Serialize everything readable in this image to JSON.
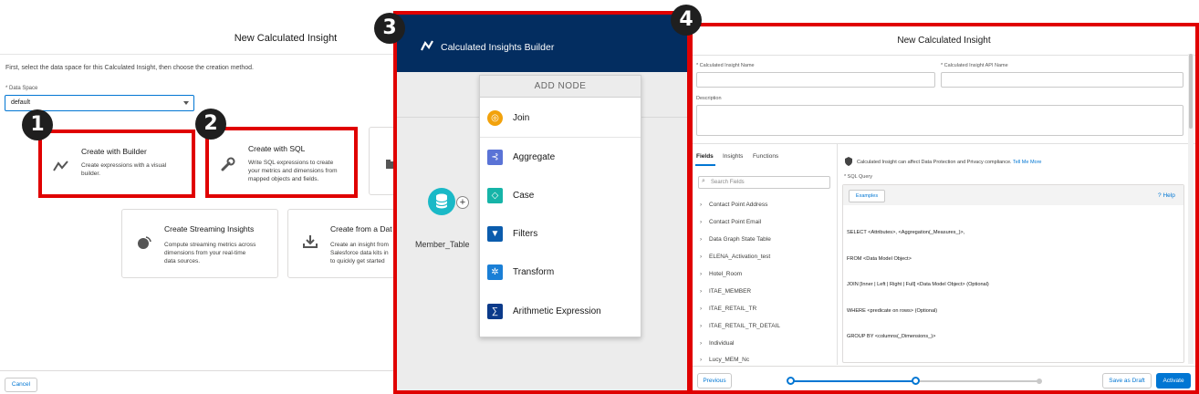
{
  "chooser": {
    "title": "New Calculated Insight",
    "intro": "First, select the data space for this Calculated Insight, then choose the creation method.",
    "data_space_label": "* Data Space",
    "data_space_value": "default",
    "cards": {
      "builder": {
        "title": "Create with Builder",
        "desc_1": "Create expressions with a visual",
        "desc_2": "builder."
      },
      "sql": {
        "title": "Create with SQL",
        "desc_1": "Write SQL expressions to create",
        "desc_2": "your metrics and dimensions from",
        "desc_3": "mapped objects and fields."
      },
      "streaming": {
        "title": "Create Streaming Insights",
        "desc_1": "Compute streaming metrics across",
        "desc_2": "dimensions from your real-time",
        "desc_3": "data sources."
      },
      "data_kit": {
        "title": "Create from a Dat",
        "desc_1": "Create an insight from",
        "desc_2": "Salesforce data kits in",
        "desc_3": "to quickly get started"
      }
    },
    "cancel_label": "Cancel"
  },
  "badges": {
    "one": "1",
    "two": "2",
    "three": "3",
    "four": "4"
  },
  "builder": {
    "header_title": "Calculated Insights Builder",
    "node_label": "Member_Table",
    "add_node_title": "ADD NODE",
    "items": [
      {
        "label": "Join",
        "icon": "join-icon",
        "color": "#f2a20c"
      },
      {
        "label": "Aggregate",
        "icon": "aggregate-icon",
        "color": "#5a73d6"
      },
      {
        "label": "Case",
        "icon": "case-icon",
        "color": "#16b4a8"
      },
      {
        "label": "Filters",
        "icon": "filter-icon",
        "color": "#0b5cad"
      },
      {
        "label": "Transform",
        "icon": "transform-icon",
        "color": "#1a7fd6"
      },
      {
        "label": "Arithmetic Expression",
        "icon": "sigma-icon",
        "color": "#0b3a8a"
      }
    ]
  },
  "editor": {
    "title": "New Calculated Insight",
    "label_name": "* Calculated Insight Name",
    "label_api": "* Calculated Insight API Name",
    "label_desc": "Description",
    "tabs": {
      "fields": "Fields",
      "insights": "Insights",
      "functions": "Functions"
    },
    "search_placeholder": "Search Fields",
    "fields": [
      "Contact Point Address",
      "Contact Point Email",
      "Data Graph State Table",
      "ELENA_Activation_test",
      "Hotel_Room",
      "ITAE_MEMBER",
      "ITAE_RETAIL_TR",
      "ITAE_RETAIL_TR_DETAIL",
      "Individual",
      "Lucy_MEM_Nc"
    ],
    "warning_text": "Calculated Insight can affect Data Protection and Privacy compliance.",
    "warning_link": "Tell Me More",
    "sql_label": "* SQL Query",
    "examples_label": "Examples",
    "help_label": "Help",
    "code": [
      "SELECT <Attributes>, <Aggregation(_Measures_)>,",
      "FROM <Data Model Object>",
      "JOIN [Inner | Left | Right | Full] <Data Model Object> (Optional)",
      "WHERE <predicate on rows> (Optional)",
      "GROUP BY <columns(_Dimensions_)>"
    ],
    "previous_label": "Previous",
    "save_label": "Save as Draft",
    "activate_label": "Activate"
  }
}
